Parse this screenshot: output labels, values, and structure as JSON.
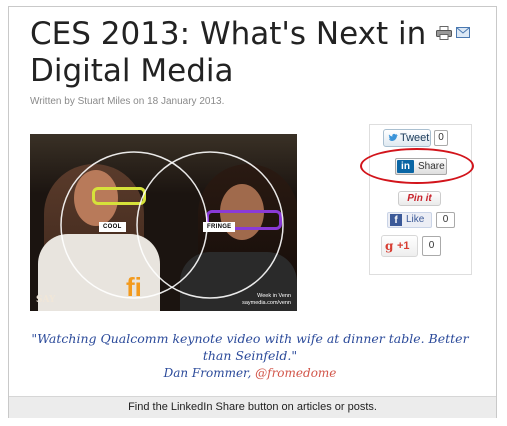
{
  "article": {
    "title": "CES 2013: What's Next in Digital Media",
    "byline": "Written by Stuart Miles on 18 January 2013."
  },
  "toolbar": {
    "print_icon": "print-icon",
    "email_icon": "email-icon"
  },
  "photo": {
    "label_cool": "COOL",
    "label_fringe": "FRINGE",
    "watermark": "SAY",
    "corner_line1": "Week in Venn",
    "corner_line2": "saymedia.com/venn"
  },
  "share": {
    "tweet_label": "Tweet",
    "tweet_count": "0",
    "linkedin_logo": "in",
    "linkedin_label": "Share",
    "pin_label": "Pin it",
    "fb_logo": "f",
    "fb_label": "Like",
    "fb_count": "0",
    "gplus_g": "g",
    "gplus_label": "+1",
    "gplus_count": "0",
    "highlight_color": "#d2141b"
  },
  "quote": {
    "text": "\"Watching Qualcomm keynote video with wife at dinner table. Better than Seinfeld.\"",
    "author": "Dan Frommer,",
    "handle": "@fromedome"
  },
  "caption": "Find the LinkedIn Share button on articles or posts."
}
